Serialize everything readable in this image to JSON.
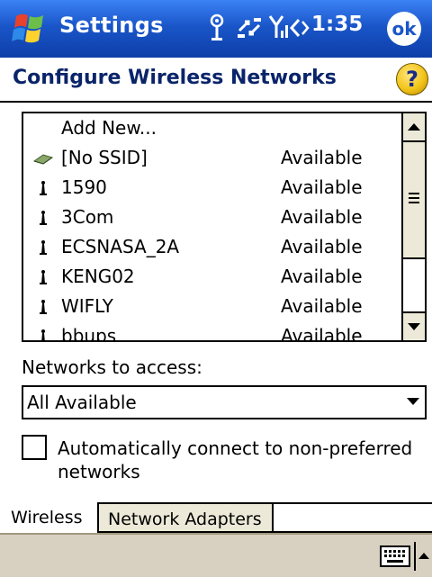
{
  "titlebar": {
    "title": "Settings",
    "time": "1:35",
    "ok_label": "ok",
    "icons": [
      "windows-start-icon",
      "antenna-icon",
      "connectivity-icon",
      "signal-icon",
      "volume-icon"
    ]
  },
  "header": {
    "title": "Configure Wireless Networks",
    "help_icon": "help-icon",
    "help_glyph": "?"
  },
  "network_list": {
    "add_new_label": "Add New...",
    "networks": [
      {
        "ssid": "[No SSID]",
        "status": "Available",
        "icon": "ad-hoc-network-icon"
      },
      {
        "ssid": "1590",
        "status": "Available",
        "icon": "access-point-icon"
      },
      {
        "ssid": "3Com",
        "status": "Available",
        "icon": "access-point-icon"
      },
      {
        "ssid": "ECSNASA_2A",
        "status": "Available",
        "icon": "access-point-icon"
      },
      {
        "ssid": "KENG02",
        "status": "Available",
        "icon": "access-point-icon"
      },
      {
        "ssid": "WIFLY",
        "status": "Available",
        "icon": "access-point-icon"
      },
      {
        "ssid": "bbups",
        "status": "Available",
        "icon": "access-point-icon"
      }
    ]
  },
  "access": {
    "label": "Networks to access:",
    "selected": "All Available"
  },
  "auto_connect": {
    "label": "Automatically connect to non-preferred networks",
    "checked": false
  },
  "tabs": [
    {
      "label": "Wireless",
      "active": true
    },
    {
      "label": "Network Adapters",
      "active": false
    }
  ],
  "bottom_bar": {
    "icons": [
      "keyboard-icon",
      "sip-up-arrow-icon"
    ]
  },
  "colors": {
    "titlebar": "#1a56c9",
    "page_title": "#0a246a",
    "tab_inactive": "#ece9d8",
    "bottom_bar": "#d8d0c0"
  }
}
